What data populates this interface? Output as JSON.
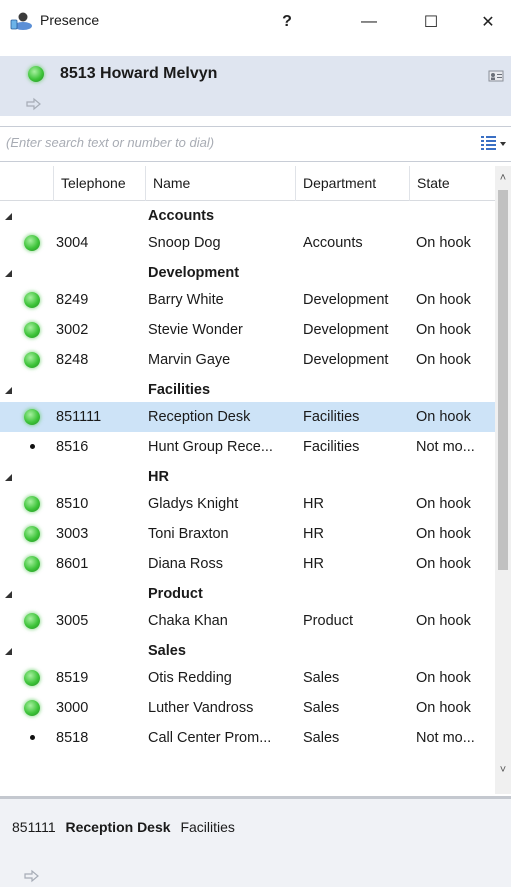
{
  "window": {
    "title": "Presence",
    "help_label": "?",
    "minimize_label": "—",
    "maximize_label": "☐",
    "close_label": "✕"
  },
  "user": {
    "name": "8513 Howard Melvyn",
    "status_color": "#3ec43a"
  },
  "search": {
    "placeholder": "(Enter search text or number to dial)",
    "value": ""
  },
  "table": {
    "headers": {
      "telephone": "Telephone",
      "name": "Name",
      "department": "Department",
      "state": "State"
    }
  },
  "groups": [
    {
      "label": "Accounts",
      "rows": [
        {
          "status": "online",
          "telephone": "3004",
          "name": "Snoop Dog",
          "department": "Accounts",
          "state": "On hook"
        }
      ]
    },
    {
      "label": "Development",
      "rows": [
        {
          "status": "online",
          "telephone": "8249",
          "name": "Barry White",
          "department": "Development",
          "state": "On hook"
        },
        {
          "status": "online",
          "telephone": "3002",
          "name": "Stevie Wonder",
          "department": "Development",
          "state": "On hook"
        },
        {
          "status": "online",
          "telephone": "8248",
          "name": "Marvin Gaye",
          "department": "Development",
          "state": "On hook"
        }
      ]
    },
    {
      "label": "Facilities",
      "rows": [
        {
          "status": "online",
          "telephone": "851111",
          "name": "Reception Desk",
          "department": "Facilities",
          "state": "On hook",
          "selected": true
        },
        {
          "status": "none",
          "telephone": "8516",
          "name": "Hunt Group Rece...",
          "department": "Facilities",
          "state": "Not mo..."
        }
      ]
    },
    {
      "label": "HR",
      "rows": [
        {
          "status": "online",
          "telephone": "8510",
          "name": "Gladys Knight",
          "department": "HR",
          "state": "On hook"
        },
        {
          "status": "online",
          "telephone": "3003",
          "name": "Toni Braxton",
          "department": "HR",
          "state": "On hook"
        },
        {
          "status": "online",
          "telephone": "8601",
          "name": "Diana Ross",
          "department": "HR",
          "state": "On hook"
        }
      ]
    },
    {
      "label": "Product",
      "rows": [
        {
          "status": "online",
          "telephone": "3005",
          "name": "Chaka Khan",
          "department": "Product",
          "state": "On hook"
        }
      ]
    },
    {
      "label": "Sales",
      "rows": [
        {
          "status": "online",
          "telephone": "8519",
          "name": "Otis Redding",
          "department": "Sales",
          "state": "On hook"
        },
        {
          "status": "online",
          "telephone": "3000",
          "name": "Luther Vandross",
          "department": "Sales",
          "state": "On hook"
        },
        {
          "status": "none",
          "telephone": "8518",
          "name": "Call Center Prom...",
          "department": "Sales",
          "state": "Not mo..."
        }
      ]
    }
  ],
  "detail": {
    "telephone": "851111",
    "name": "Reception Desk",
    "department": "Facilities"
  },
  "colors": {
    "header_band": "#dfe5f0",
    "selected_row": "#cde3f7",
    "online_green": "#3ec43a"
  }
}
